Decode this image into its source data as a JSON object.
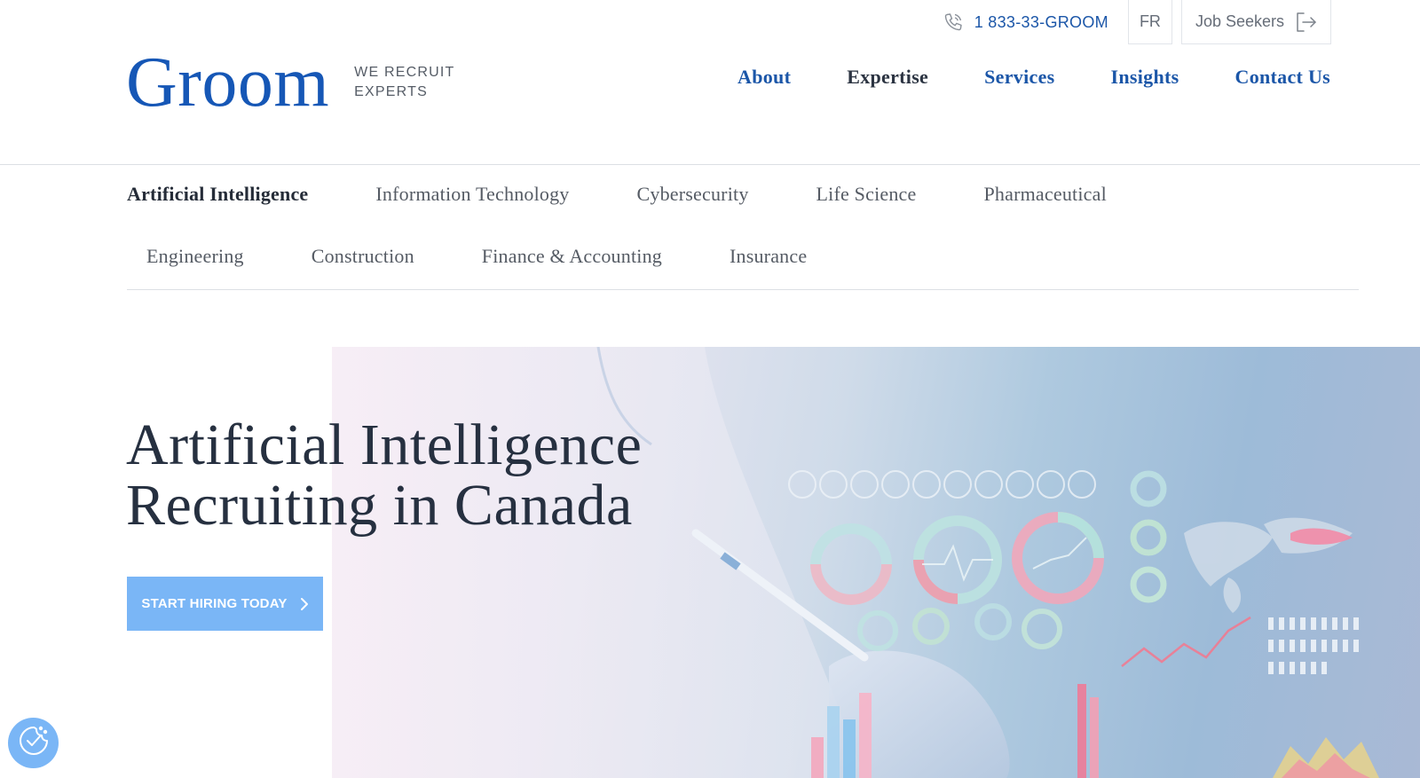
{
  "utility": {
    "phone_icon": "phone-icon",
    "phone_number": "1 833-33-GROOM",
    "lang": "FR",
    "job_seekers": "Job Seekers",
    "job_seekers_icon": "sign-in-arrow-icon"
  },
  "brand": {
    "logo_text": "Groom",
    "tagline": "WE RECRUIT EXPERTS",
    "color": "#1657b6"
  },
  "main_nav": [
    {
      "label": "About"
    },
    {
      "label": "Expertise"
    },
    {
      "label": "Services"
    },
    {
      "label": "Insights"
    },
    {
      "label": "Contact Us"
    }
  ],
  "categories_row1": [
    {
      "label": "Artificial Intelligence"
    },
    {
      "label": "Information Technology"
    },
    {
      "label": "Cybersecurity"
    },
    {
      "label": "Life Science"
    },
    {
      "label": "Pharmaceutical"
    }
  ],
  "categories_row2": [
    {
      "label": "Engineering"
    },
    {
      "label": "Construction"
    },
    {
      "label": "Finance & Accounting"
    },
    {
      "label": "Insurance"
    }
  ],
  "hero": {
    "title_line1": "Artificial Intelligence",
    "title_line2": "Recruiting in Canada",
    "cta_label": "START HIRING TODAY",
    "cta_color": "#7ab6f6",
    "cta_icon": "chevron-right-icon",
    "image": "hero-analytics-image"
  },
  "cookie": {
    "icon": "cookie-consent-icon"
  }
}
